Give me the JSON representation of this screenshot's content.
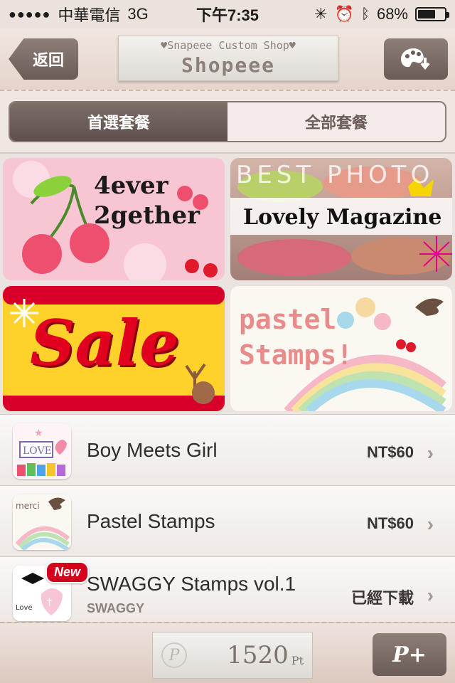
{
  "status_bar": {
    "carrier": "中華電信",
    "signal_dots": "●●●●●",
    "network": "3G",
    "time": "下午7:35",
    "battery": "68%",
    "battery_level": 0.68
  },
  "nav": {
    "back_label": "返回",
    "title_sub": "♥Snapeee Custom Shop♥",
    "title_main": "Shopeee",
    "palette_icon": "palette-download-icon"
  },
  "segment": {
    "tabs": [
      {
        "label": "首選套餐",
        "active": true
      },
      {
        "label": "全部套餐",
        "active": false
      }
    ]
  },
  "banners": [
    {
      "text_line1": "4ever",
      "text_line2": "2gether"
    },
    {
      "header": "BEST PHOTO",
      "text": "Lovely Magazine"
    },
    {
      "text": "Sale"
    },
    {
      "text_line1": "pastel",
      "text_line2": "Stamps!"
    }
  ],
  "list": {
    "items": [
      {
        "title": "Boy Meets Girl",
        "price": "NT$60"
      },
      {
        "title": "Pastel Stamps",
        "price": "NT$60"
      },
      {
        "title": "SWAGGY Stamps vol.1",
        "subtitle": "SWAGGY",
        "price": "已經下載",
        "badge": "New"
      }
    ]
  },
  "bottom": {
    "coin_symbol": "P",
    "points": "1520",
    "points_unit": "Pt",
    "add_label": "P+"
  },
  "colors": {
    "accent_brown": "#6b5c57",
    "sale_red": "#e1001e",
    "new_badge": "#d4001c"
  }
}
